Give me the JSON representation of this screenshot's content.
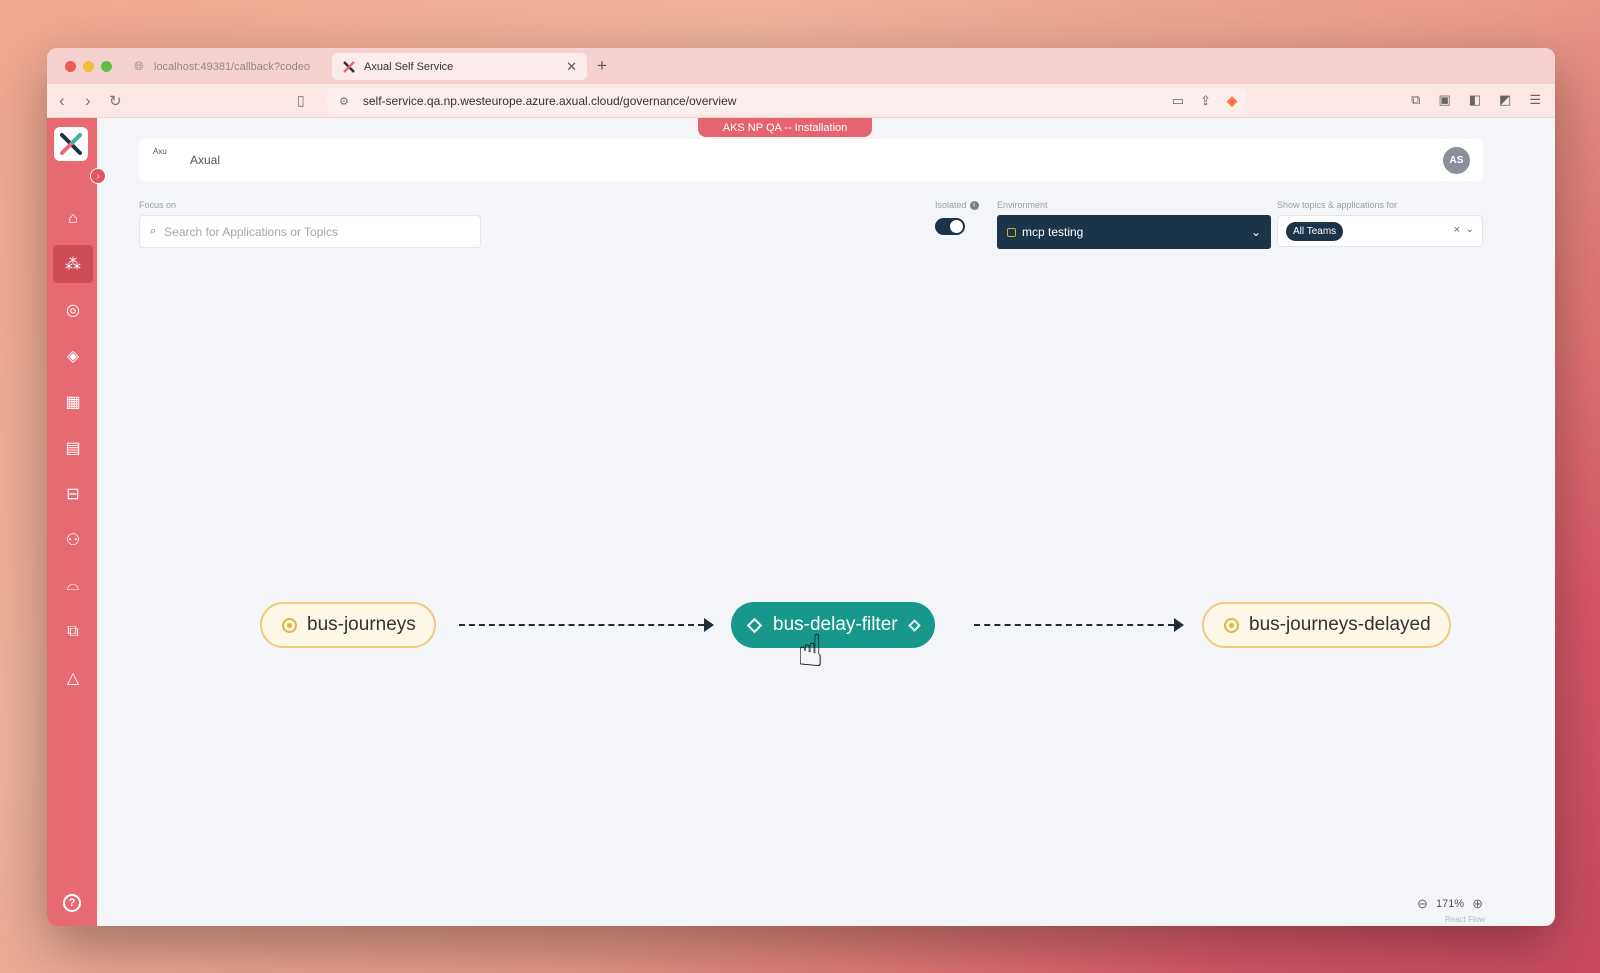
{
  "browser": {
    "tabs": [
      {
        "title": "localhost:49381/callback?codeo",
        "active": false
      },
      {
        "title": "Axual Self Service",
        "active": true
      }
    ],
    "new_tab": "+",
    "url": "self-service.qa.np.westeurope.azure.axual.cloud/governance/overview"
  },
  "banner": "AKS NP QA -- Installation",
  "header": {
    "brand_alt": "Axu",
    "brand": "Axual",
    "avatar_initials": "AS"
  },
  "filters": {
    "focus_label": "Focus on",
    "search_placeholder": "Search for Applications or Topics",
    "isolated_label": "Isolated",
    "isolated_on": true,
    "environment_label": "Environment",
    "environment_value": "mcp testing",
    "teams_label": "Show topics & applications for",
    "teams_chip": "All Teams",
    "clear": "×"
  },
  "graph": {
    "source_topic": "bus-journeys",
    "application": "bus-delay-filter",
    "target_topic": "bus-journeys-delayed"
  },
  "zoom": {
    "level": "171%",
    "attribution": "React Flow"
  },
  "colors": {
    "sidebar": "#e76a72",
    "app_node": "#17988a",
    "topic_border": "#eecc7f",
    "env_select": "#1b3448"
  }
}
